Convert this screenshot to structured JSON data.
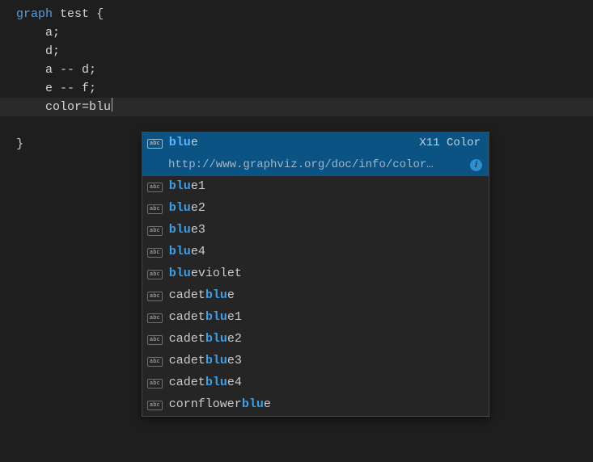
{
  "code": {
    "keyword": "graph",
    "graphName": "test",
    "openBrace": "{",
    "closeBrace": "}",
    "lines": {
      "l1": "a;",
      "l2": "d;",
      "l3": "a -- d;",
      "l4": "e -- f;",
      "l5_attr": "color=",
      "l5_typed": "blu"
    }
  },
  "suggest": {
    "selected": {
      "pre": "blu",
      "post": "e",
      "kind": "X11 Color",
      "detailUrl": "http://www.graphviz.org/doc/info/color…"
    },
    "items": [
      {
        "pre": "blu",
        "post": "e1"
      },
      {
        "pre": "blu",
        "post": "e2"
      },
      {
        "pre": "blu",
        "post": "e3"
      },
      {
        "pre": "blu",
        "post": "e4"
      },
      {
        "pre": "blu",
        "post": "eviolet"
      },
      {
        "preText": "cadet",
        "match": "blu",
        "post": "e"
      },
      {
        "preText": "cadet",
        "match": "blu",
        "post": "e1"
      },
      {
        "preText": "cadet",
        "match": "blu",
        "post": "e2"
      },
      {
        "preText": "cadet",
        "match": "blu",
        "post": "e3"
      },
      {
        "preText": "cadet",
        "match": "blu",
        "post": "e4"
      },
      {
        "preText": "cornflower",
        "match": "blu",
        "post": "e"
      }
    ],
    "iconText": "abc",
    "infoGlyph": "i"
  }
}
